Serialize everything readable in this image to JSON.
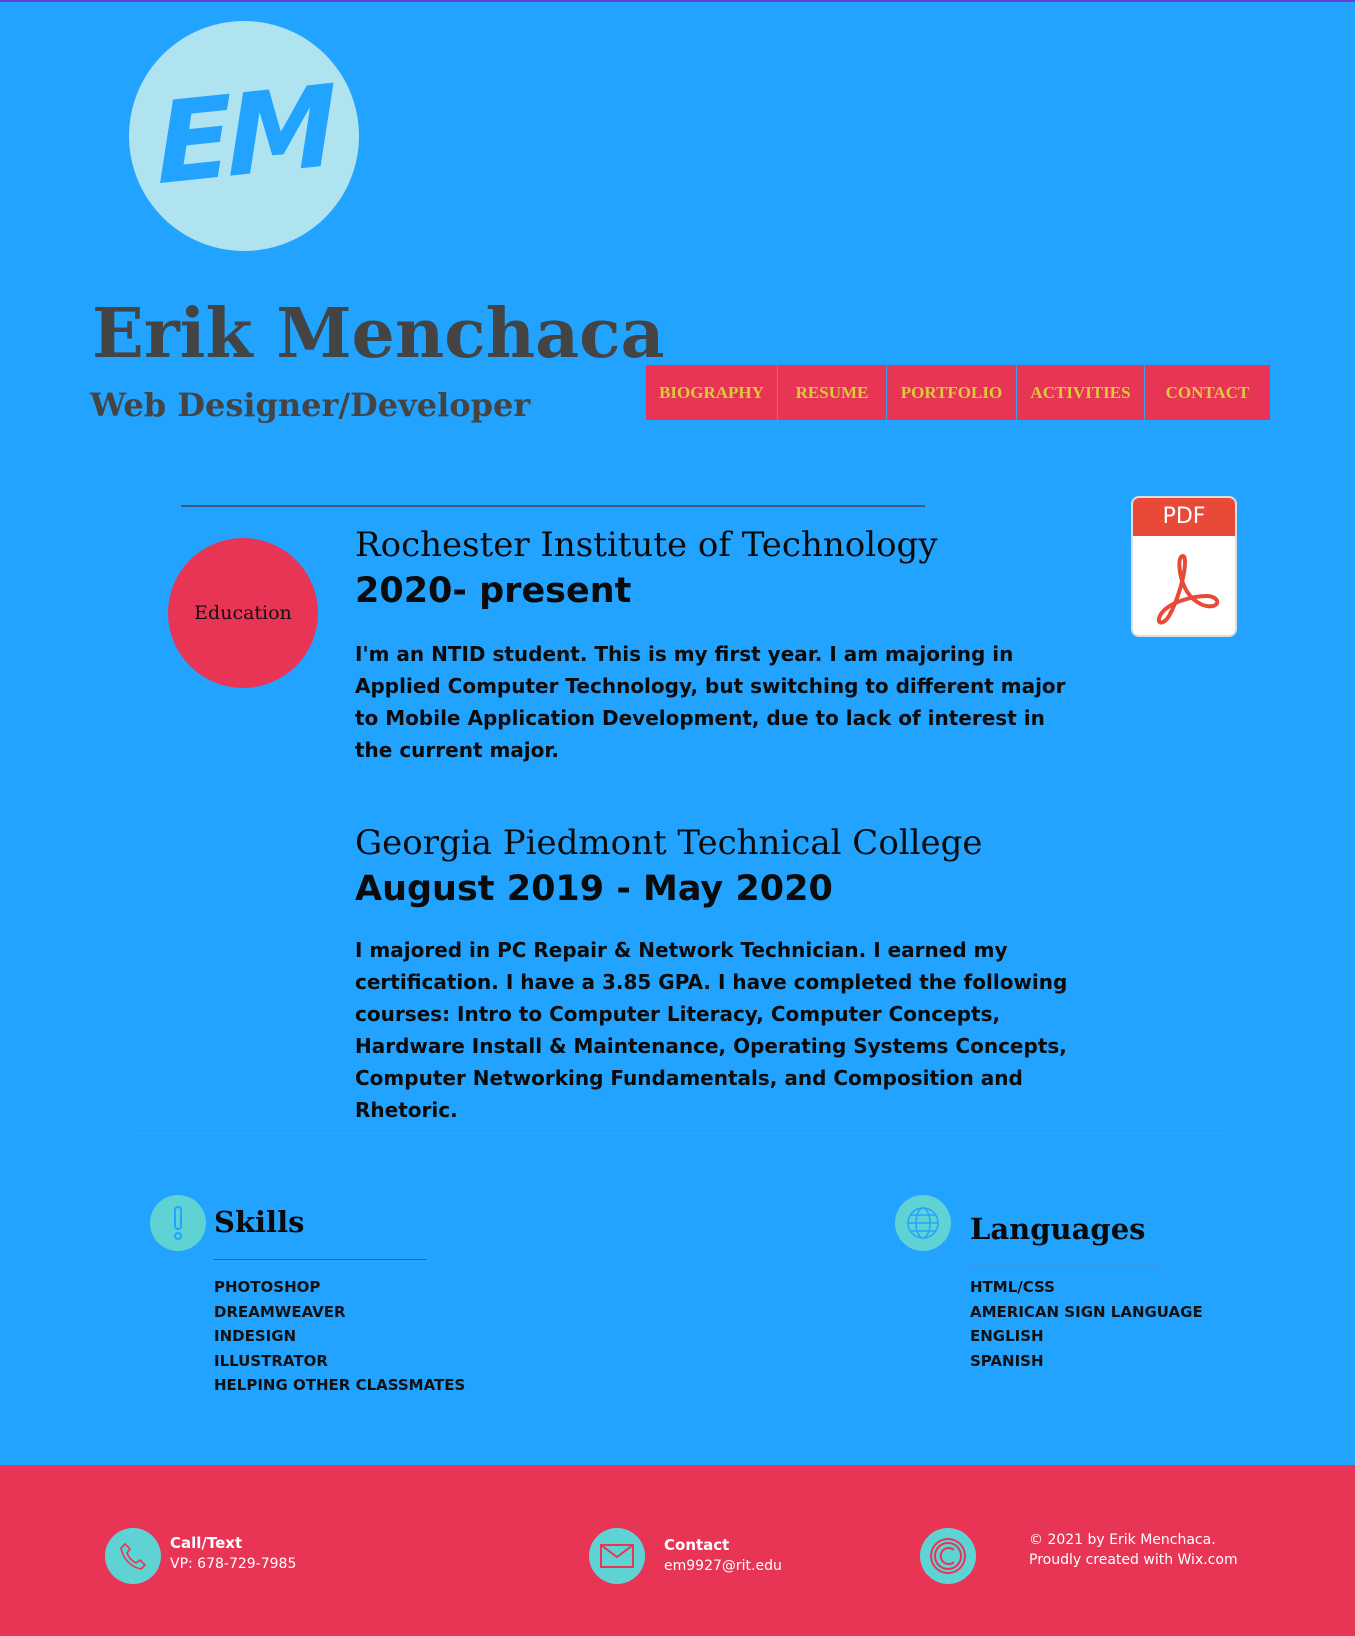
{
  "header": {
    "logo_text": "EM",
    "name": "Erik Menchaca",
    "subtitle": "Web Designer/Developer"
  },
  "nav": {
    "items": [
      {
        "label": "BIOGRAPHY"
      },
      {
        "label": "RESUME"
      },
      {
        "label": "PORTFOLIO"
      },
      {
        "label": "ACTIVITIES"
      },
      {
        "label": "CONTACT"
      }
    ]
  },
  "education": {
    "badge": "Education",
    "pdf_label": "PDF",
    "entries": [
      {
        "school": "Rochester Institute of Technology",
        "dates": "2020- present",
        "description": "I'm an NTID student. This is my first year. I am majoring in Applied Computer Technology, but switching to different major to Mobile Application Development, due to lack of interest in the current major."
      },
      {
        "school": "Georgia Piedmont Technical College",
        "dates": "August 2019 - May 2020",
        "description": "I majored in PC Repair & Network Technician. I earned my certification. I have a 3.85 GPA. I have completed the following courses: Intro to Computer Literacy, Computer Concepts, Hardware Install & Maintenance, Operating Systems Concepts, Computer Networking Fundamentals, and Composition and Rhetoric."
      }
    ]
  },
  "skills": {
    "title": "Skills",
    "items": [
      "PHOTOSHOP",
      "DREAMWEAVER",
      "INDESIGN",
      "ILLUSTRATOR",
      "HELPING OTHER CLASSMATES"
    ]
  },
  "languages": {
    "title": "Languages",
    "items": [
      "HTML/CSS",
      "AMERICAN SIGN LANGUAGE",
      "ENGLISH",
      "SPANISH"
    ]
  },
  "footer": {
    "call_title": "Call/Text",
    "call_value": "VP: 678-729-7985",
    "contact_title": "Contact",
    "contact_value": "em9927@rit.edu",
    "copyright_line1": "© 2021 by Erik Menchaca.",
    "copyright_line2": "Proudly created with Wix.com"
  },
  "colors": {
    "background": "#22a3ff",
    "accent": "#e83455",
    "nav_text": "#d9cb3a",
    "icon_circle": "#5fd3d3"
  }
}
